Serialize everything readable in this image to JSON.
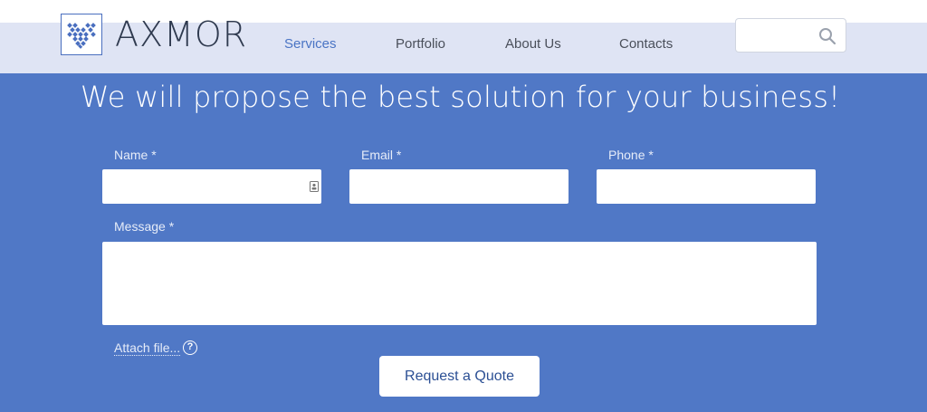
{
  "header": {
    "logo_text": "AXMOR",
    "nav": [
      {
        "label": "Services",
        "active": true
      },
      {
        "label": "Portfolio",
        "active": false
      },
      {
        "label": "About Us",
        "active": false
      },
      {
        "label": "Contacts",
        "active": false
      }
    ],
    "search": {
      "value": "",
      "icon": "search-icon"
    }
  },
  "form": {
    "heading": "We will propose the best solution for your business!",
    "name_label": "Name *",
    "email_label": "Email *",
    "phone_label": "Phone *",
    "message_label": "Message *",
    "name_value": "",
    "email_value": "",
    "phone_value": "",
    "message_value": "",
    "attach_label": "Attach file...",
    "help_symbol": "?",
    "submit_label": "Request a Quote"
  },
  "colors": {
    "brand_blue": "#5078c6",
    "header_bg": "#dfe4f4",
    "active_nav": "#4a74c4"
  }
}
